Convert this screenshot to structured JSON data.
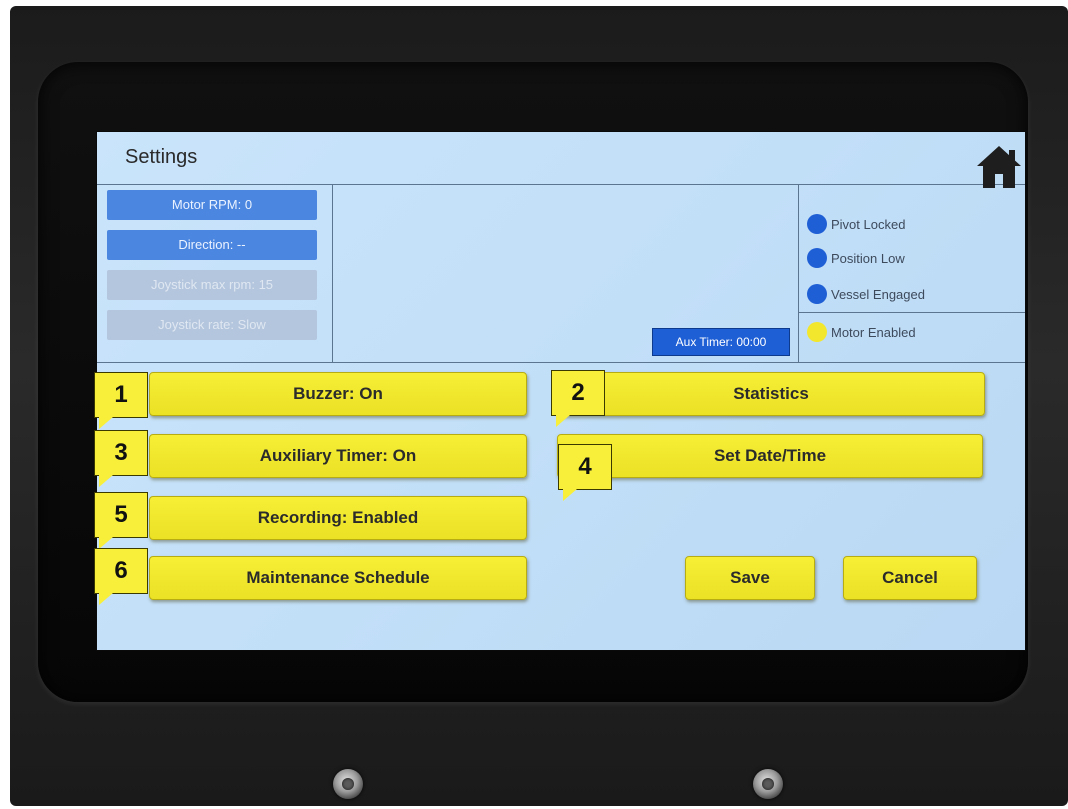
{
  "screen": {
    "title": "Settings",
    "home_icon": "home-icon"
  },
  "status_left": {
    "motor_rpm": "Motor RPM: 0",
    "direction": "Direction: --",
    "joystick_max_rpm": "Joystick max rpm: 15",
    "joystick_rate": "Joystick rate: Slow"
  },
  "status_center": {
    "aux_timer": "Aux Timer: 00:00"
  },
  "indicators": [
    {
      "label": "Pivot Locked",
      "color": "#1f5fd6"
    },
    {
      "label": "Position Low",
      "color": "#1f5fd6"
    },
    {
      "label": "Vessel Engaged",
      "color": "#1f5fd6"
    },
    {
      "label": "Motor Enabled",
      "color": "#f2e72c"
    }
  ],
  "buttons": {
    "buzzer": "Buzzer: On",
    "statistics": "Statistics",
    "auxiliary_timer": "Auxiliary Timer: On",
    "set_date_time": "Set Date/Time",
    "recording": "Recording: Enabled",
    "maintenance_schedule": "Maintenance Schedule",
    "save": "Save",
    "cancel": "Cancel"
  },
  "callouts": [
    "1",
    "2",
    "3",
    "4",
    "5",
    "6"
  ],
  "colors": {
    "button_yellow": "#f2e72c",
    "screen_background": "#c4e0f8",
    "status_blue": "#4b86e0"
  }
}
